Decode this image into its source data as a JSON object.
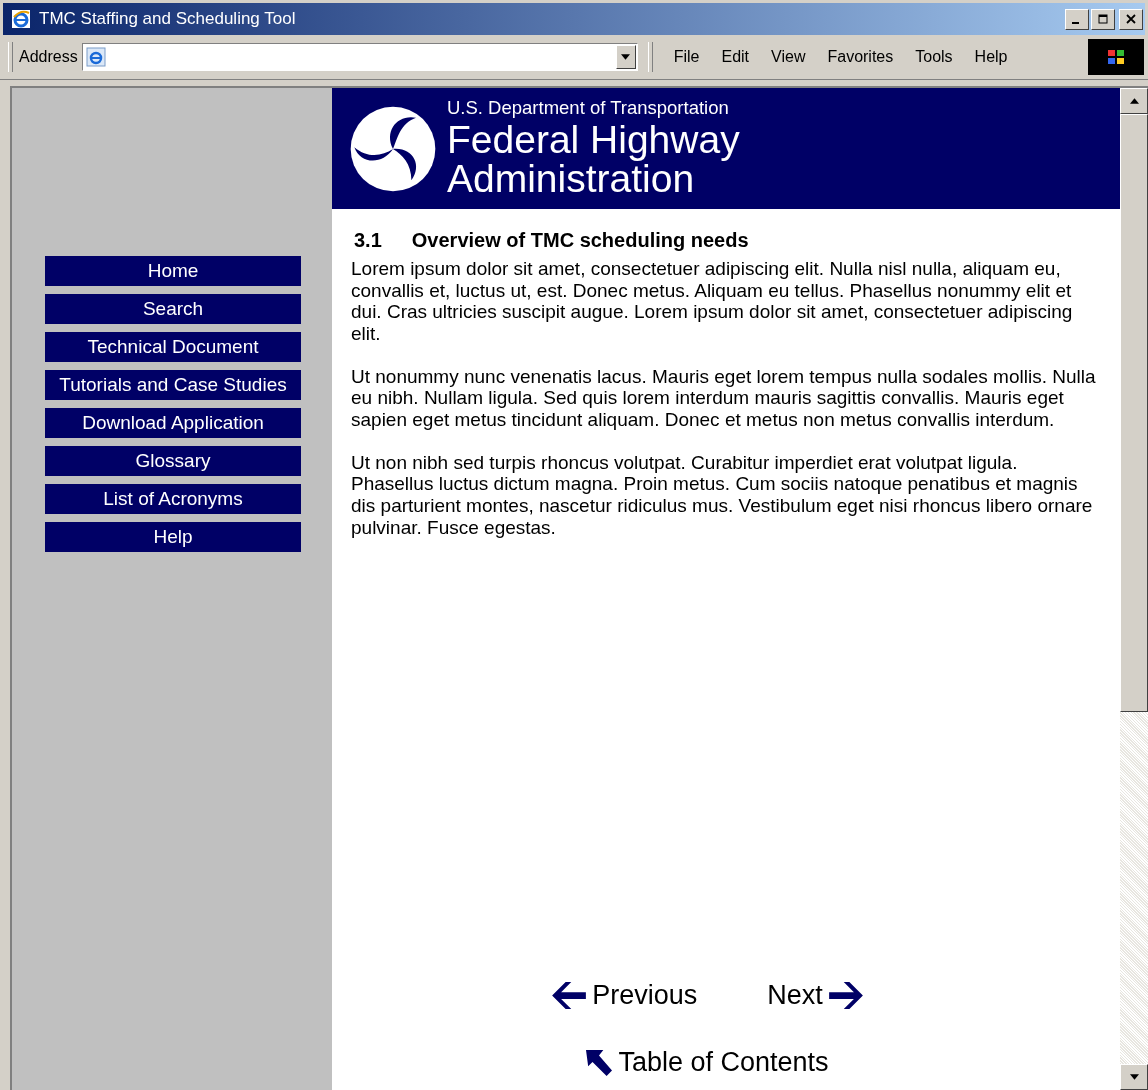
{
  "window": {
    "title": "TMC Staffing and Scheduling Tool"
  },
  "toolbar": {
    "address_label": "Address",
    "menu": [
      "File",
      "Edit",
      "View",
      "Favorites",
      "Tools",
      "Help"
    ]
  },
  "sidebar": {
    "items": [
      "Home",
      "Search",
      "Technical Document",
      "Tutorials and Case Studies",
      "Download Application",
      "Glossary",
      "List of Acronyms",
      "Help"
    ]
  },
  "banner": {
    "department": "U.S. Department of Transportation",
    "agency_line_1": "Federal Highway",
    "agency_line_2": "Administration"
  },
  "content": {
    "section_number": "3.1",
    "heading": "Overview of TMC scheduling needs",
    "paragraphs": [
      "Lorem ipsum dolor sit amet, consectetuer adipiscing elit. Nulla nisl nulla, aliquam eu, convallis et, luctus ut, est. Donec metus. Aliquam eu tellus. Phasellus nonummy elit et dui. Cras ultricies suscipit augue. Lorem ipsum dolor sit amet, consectetuer adipiscing elit.",
      "Ut nonummy nunc venenatis lacus. Mauris eget lorem tempus nulla sodales mollis. Nulla eu nibh. Nullam ligula. Sed quis lorem interdum mauris sagittis convallis. Mauris eget sapien eget metus tincidunt aliquam. Donec et metus non metus convallis interdum.",
      "Ut non nibh sed turpis rhoncus volutpat. Curabitur imperdiet erat volutpat ligula. Phasellus luctus dictum magna. Proin metus. Cum sociis natoque penatibus et magnis dis parturient montes, nascetur ridiculus mus. Vestibulum eget nisi rhoncus libero ornare pulvinar. Fusce egestas."
    ]
  },
  "navigation": {
    "previous": "Previous",
    "next": "Next",
    "contents": "Table of Contents"
  }
}
